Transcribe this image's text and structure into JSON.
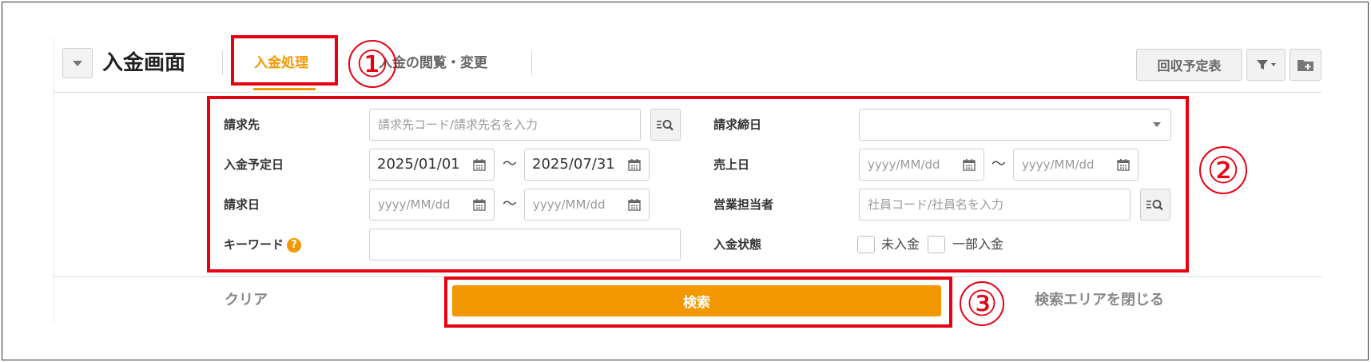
{
  "header": {
    "title": "入金画面",
    "tabs": [
      {
        "label": "入金処理",
        "active": true
      },
      {
        "label": "入金の閲覧・変更",
        "active": false
      }
    ],
    "buttons": {
      "schedule": "回収予定表",
      "filter_icon": "filter-icon",
      "add_folder_icon": "folder-plus-icon"
    }
  },
  "form": {
    "seikyusaki": {
      "label": "請求先",
      "placeholder": "請求先コード/請求先名を入力"
    },
    "shimebi": {
      "label": "請求締日",
      "value": ""
    },
    "nyukin_yoteibi": {
      "label": "入金予定日",
      "from": "2025/01/01",
      "to": "2025/07/31"
    },
    "uriagebi": {
      "label": "売上日",
      "from_placeholder": "yyyy/MM/dd",
      "to_placeholder": "yyyy/MM/dd"
    },
    "seikyubi": {
      "label": "請求日",
      "from_placeholder": "yyyy/MM/dd",
      "to_placeholder": "yyyy/MM/dd"
    },
    "eigyo_tantosha": {
      "label": "営業担当者",
      "placeholder": "社員コード/社員名を入力"
    },
    "keyword": {
      "label": "キーワード",
      "help": "?"
    },
    "nyukin_jotai": {
      "label": "入金状態",
      "options": [
        {
          "label": "未入金",
          "checked": false
        },
        {
          "label": "一部入金",
          "checked": false
        }
      ]
    },
    "range_sep": "～"
  },
  "footer": {
    "clear": "クリア",
    "search": "検索",
    "close_area": "検索エリアを閉じる"
  },
  "annotations": [
    "①",
    "②",
    "③"
  ],
  "colors": {
    "accent": "#f39800",
    "annotation": "#e60012"
  }
}
